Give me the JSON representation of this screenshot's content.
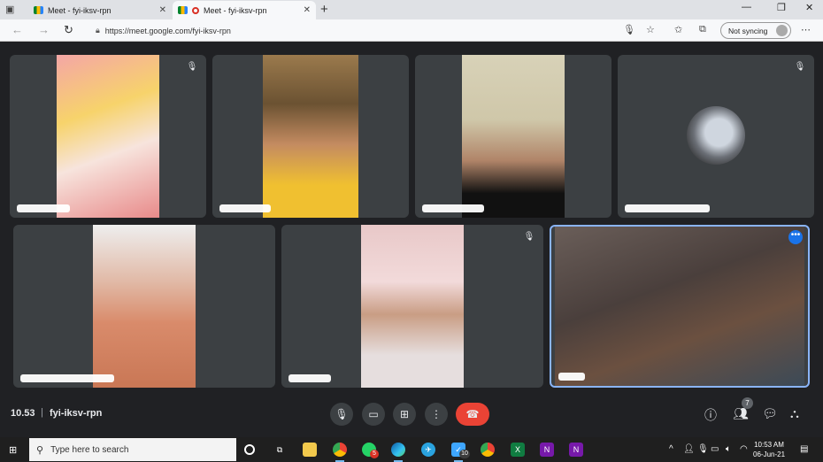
{
  "browser": {
    "tabs": [
      {
        "title": "Meet - fyi-iksv-rpn",
        "recording": false
      },
      {
        "title": "Meet - fyi-iksv-rpn",
        "recording": true
      }
    ],
    "url": "https://meet.google.com/fyi-iksv-rpn",
    "sync_label": "Not syncing"
  },
  "meeting": {
    "time": "10.53",
    "separator": "|",
    "code": "fyi-iksv-rpn",
    "participant_count": "7"
  },
  "taskbar": {
    "search_placeholder": "Type here to search",
    "clock_time": "10:53 AM",
    "clock_date": "06-Jun-21",
    "whatsapp_badge": "5",
    "telegram_badge": "10"
  },
  "colors": {
    "stage_bg": "#202124",
    "tile_bg": "#3c4043",
    "end_call": "#ea4335",
    "active_speaker_border": "#8ab4f8"
  }
}
